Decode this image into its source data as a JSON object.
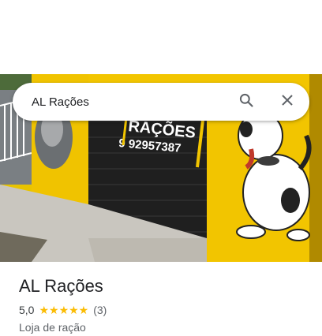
{
  "search": {
    "query": "AL Rações"
  },
  "photo": {
    "sign_name": "RAÇÕES",
    "sign_phone": "9 92957387"
  },
  "place": {
    "name": "AL Rações",
    "rating": "5,0",
    "stars": "★★★★★",
    "reviews": "(3)",
    "category": "Loja de ração"
  },
  "colors": {
    "brand_yellow": "#f2c500",
    "star": "#fbbc04"
  },
  "icons": {
    "search": "search-icon",
    "close": "close-icon"
  }
}
